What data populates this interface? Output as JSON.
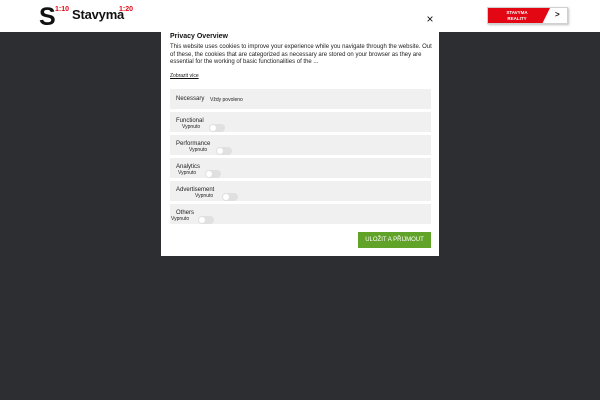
{
  "header": {
    "logo_s": "S",
    "logo_s_sup": "1:10",
    "logo_name": "Stavyma",
    "logo_name_sup": "1:20",
    "reality_line1": "STAVYMA",
    "reality_line2": "REALITY",
    "reality_arrow": ">"
  },
  "modal": {
    "close": "×",
    "title": "Privacy Overview",
    "description": "This website uses cookies to improve your experience while you navigate through the website. Out of these, the cookies that are categorized as necessary are stored on your browser as they are essential for the working of basic functionalities of the ...",
    "show_more": "Zobrazit více",
    "categories": [
      {
        "label": "Necessary",
        "status": "Vždy povoleno"
      },
      {
        "label": "Functional",
        "status": "Vypnuto"
      },
      {
        "label": "Performance",
        "status": "Vypnuto"
      },
      {
        "label": "Analytics",
        "status": "Vypnuto"
      },
      {
        "label": "Advertisement",
        "status": "Vypnuto"
      },
      {
        "label": "Others",
        "status": "Vypnuto"
      }
    ],
    "save_label": "ULOŽIT A PŘIJMOUT"
  },
  "colors": {
    "brand_red": "#e30613",
    "accept_green": "#61a229",
    "backdrop": "#2c2e31"
  }
}
